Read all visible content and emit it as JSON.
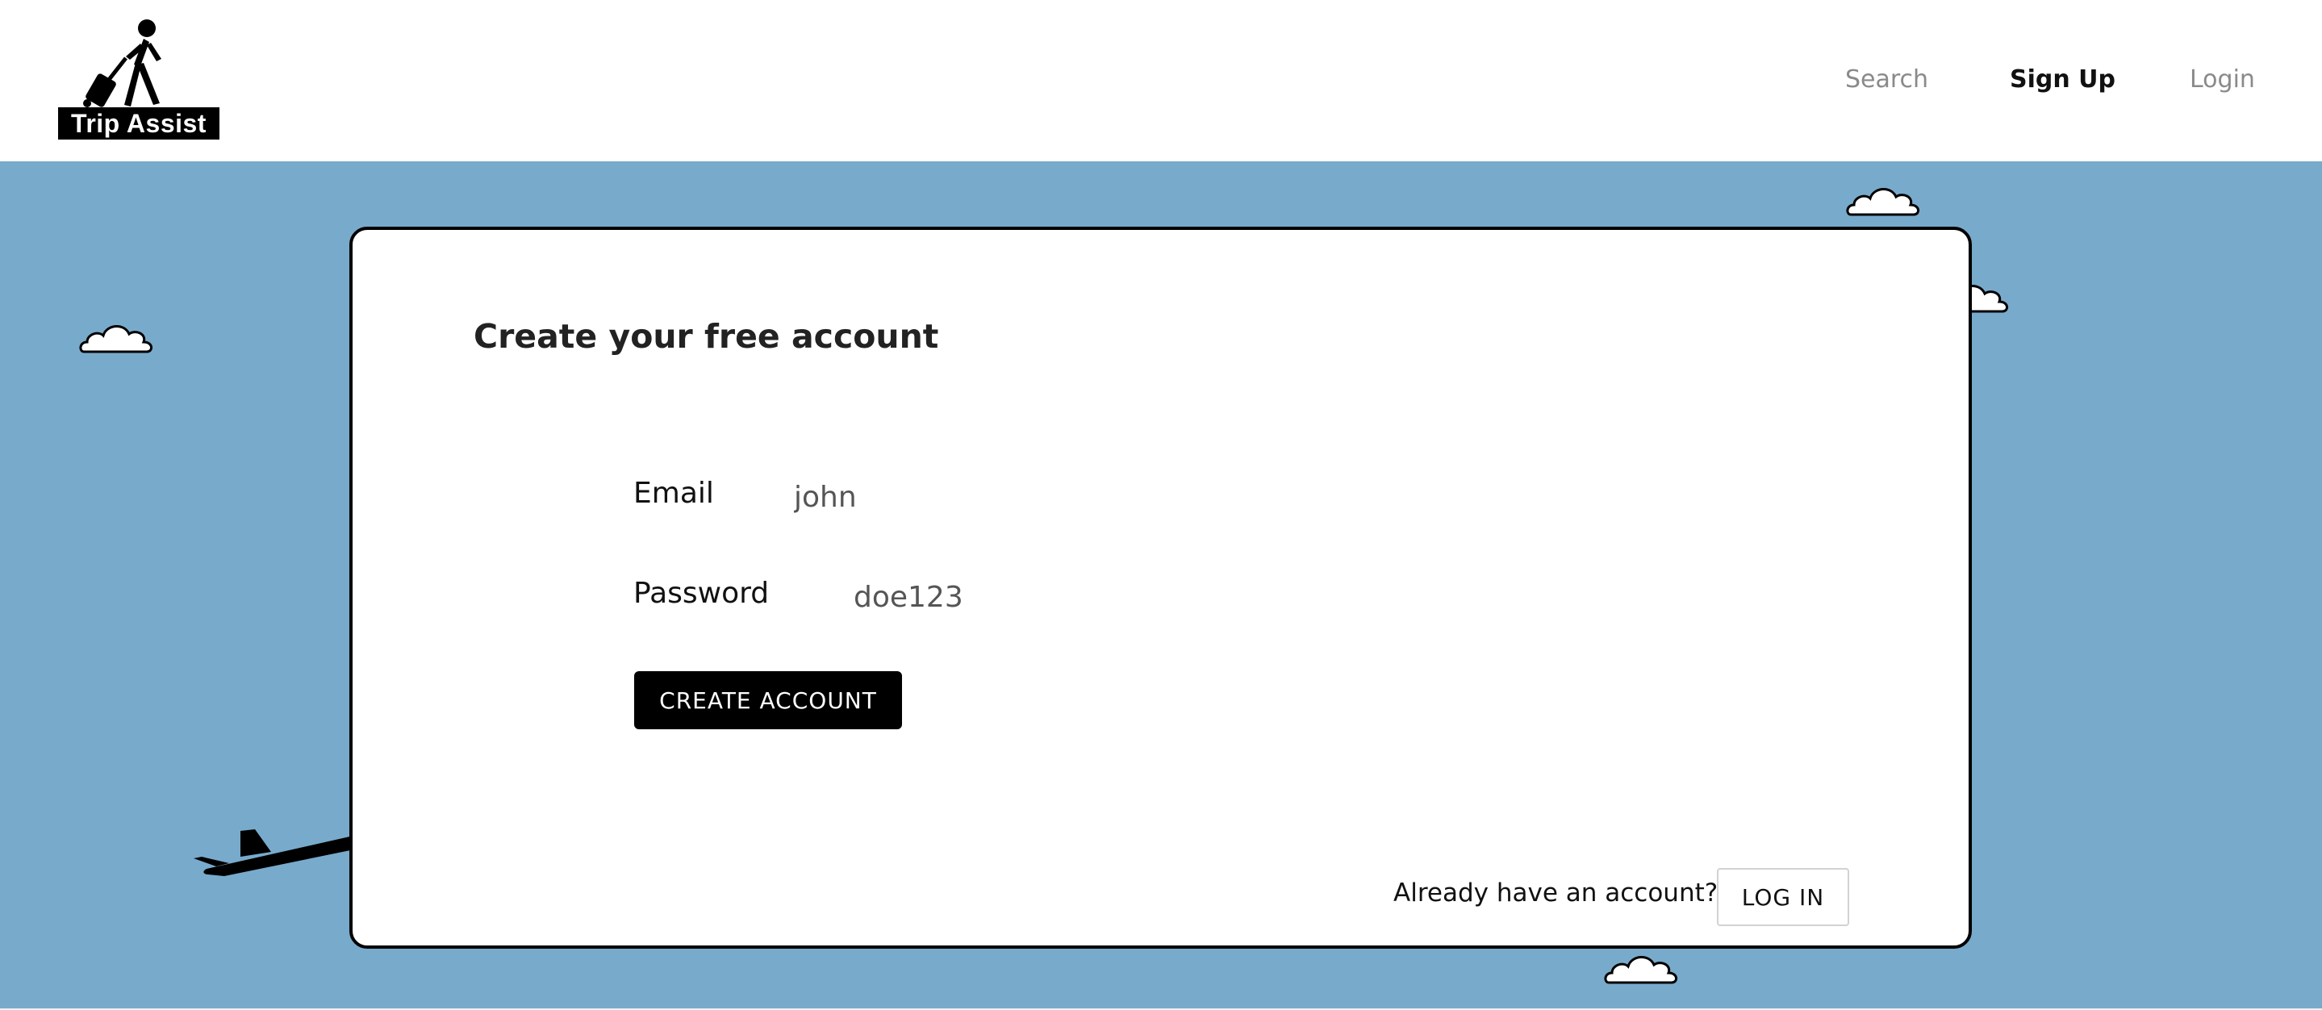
{
  "header": {
    "logo_text": "Trip Assist",
    "nav": {
      "search": "Search",
      "sign_up": "Sign Up",
      "login": "Login"
    }
  },
  "signup_card": {
    "title": "Create your free account",
    "email_label": "Email",
    "email_value": "john",
    "password_label": "Password",
    "password_value": "doe123",
    "create_button": "CREATE ACCOUNT",
    "already_text": "Already have an account?",
    "login_button": "LOG IN"
  },
  "icons": {
    "logo": "traveler-with-suitcase-icon",
    "clouds": "cloud-icon",
    "plane": "airplane-icon"
  },
  "colors": {
    "sky": "#78aacb",
    "active_nav": "#111111",
    "inactive_nav": "#8a8a8a",
    "primary_button": "#000000"
  }
}
